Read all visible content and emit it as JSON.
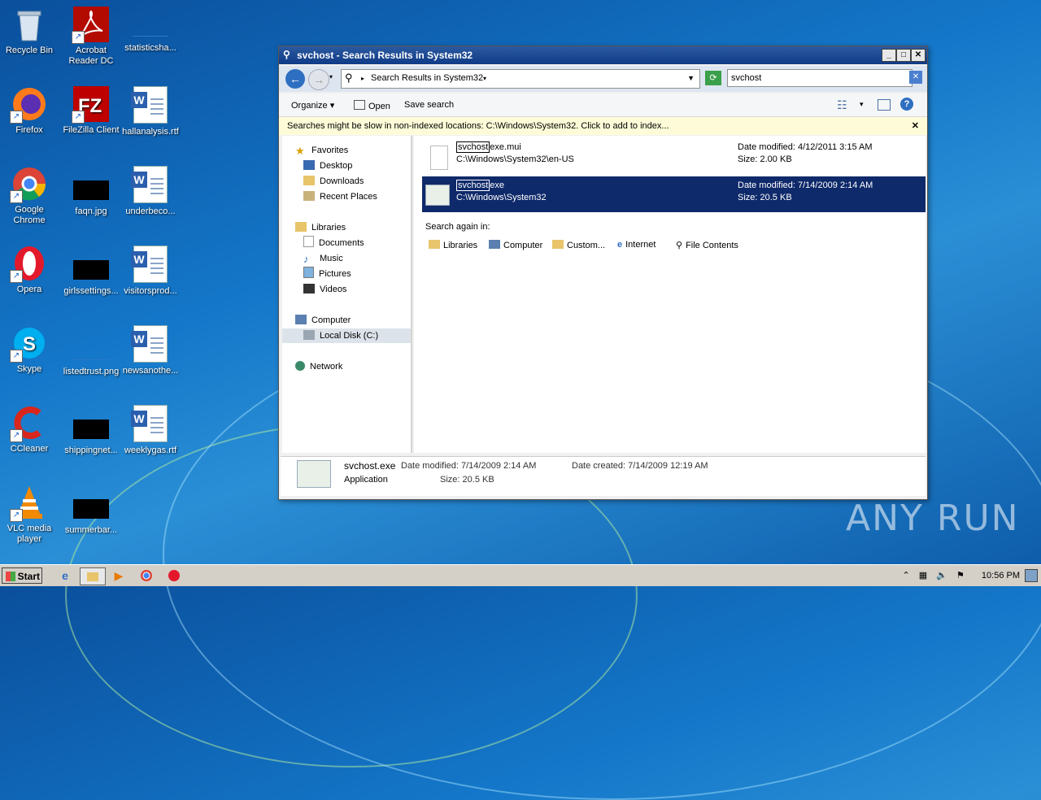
{
  "desktop": {
    "icons": [
      {
        "label": "Recycle Bin"
      },
      {
        "label": "Acrobat Reader DC"
      },
      {
        "label": "statisticsha..."
      },
      {
        "label": "Firefox"
      },
      {
        "label": "FileZilla Client"
      },
      {
        "label": "hallanalysis.rtf"
      },
      {
        "label": "Google Chrome"
      },
      {
        "label": "faqn.jpg"
      },
      {
        "label": "underbeco..."
      },
      {
        "label": "Opera"
      },
      {
        "label": "girlssettings..."
      },
      {
        "label": "visitorsprod..."
      },
      {
        "label": "Skype"
      },
      {
        "label": "listedtrust.png"
      },
      {
        "label": "newsanothe..."
      },
      {
        "label": "CCleaner"
      },
      {
        "label": "shippingnet..."
      },
      {
        "label": "weeklygas.rtf"
      },
      {
        "label": "VLC media player"
      },
      {
        "label": "summerbar..."
      }
    ]
  },
  "window": {
    "title": "svchost - Search Results in System32",
    "address": "Search Results in System32",
    "search_value": "svchost",
    "toolbar": {
      "organize": "Organize",
      "open": "Open",
      "save_search": "Save search"
    },
    "info_bar": "Searches might be slow in non-indexed locations: C:\\Windows\\System32. Click to add to index...",
    "nav": {
      "favorites": "Favorites",
      "desktop": "Desktop",
      "downloads": "Downloads",
      "recent_places": "Recent Places",
      "libraries": "Libraries",
      "documents": "Documents",
      "music": "Music",
      "pictures": "Pictures",
      "videos": "Videos",
      "computer": "Computer",
      "local_disk": "Local Disk (C:)",
      "network": "Network"
    },
    "results": [
      {
        "name_hl": "svchost",
        "name_rest": "exe.mui",
        "path": "C:\\Windows\\System32\\en-US",
        "modified": "Date modified: 4/12/2011 3:15 AM",
        "size": "Size: 2.00 KB"
      },
      {
        "name_hl": "svchost",
        "name_rest": "exe",
        "path": "C:\\Windows\\System32",
        "modified": "Date modified: 7/14/2009 2:14 AM",
        "size": "Size: 20.5 KB"
      }
    ],
    "search_again": {
      "label": "Search again in:",
      "options": [
        "Libraries",
        "Computer",
        "Custom...",
        "Internet",
        "File Contents"
      ]
    },
    "details": {
      "filename": "svchost.exe",
      "type": "Application",
      "modified_label": "Date modified:",
      "modified_value": "7/14/2009 2:14 AM",
      "size_label": "Size:",
      "size_value": "20.5 KB",
      "created_label": "Date created:",
      "created_value": "7/14/2009 12:19 AM"
    }
  },
  "taskbar": {
    "start": "Start",
    "clock": "10:56 PM"
  },
  "watermark": "ANY RUN"
}
